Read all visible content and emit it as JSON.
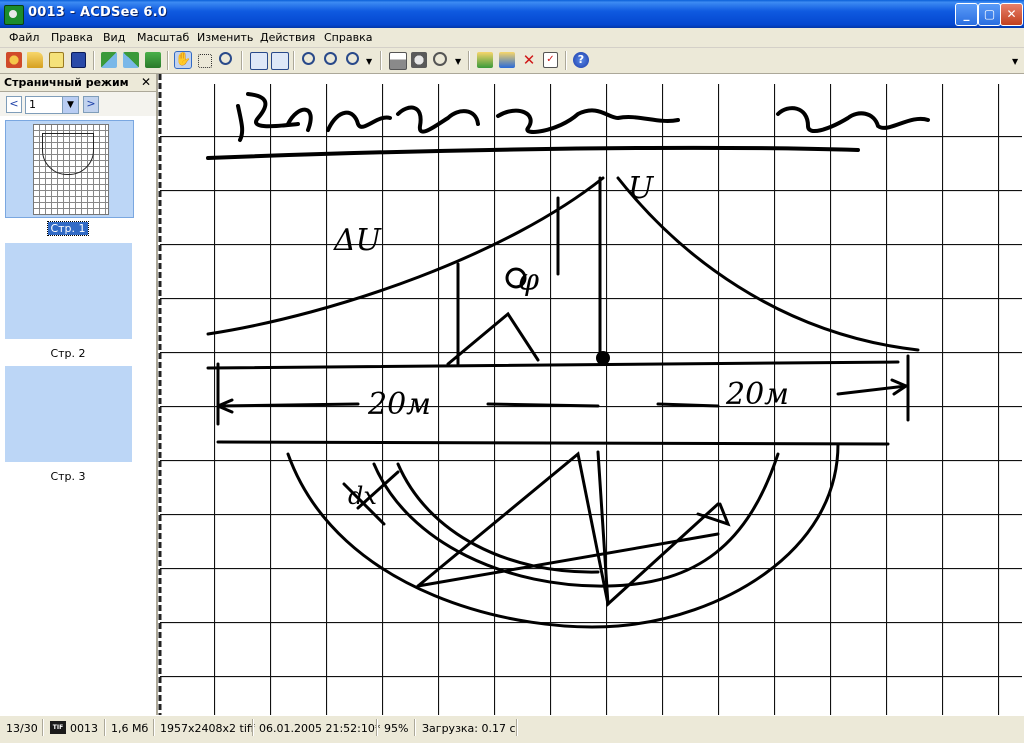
{
  "window": {
    "title": "0013 - ACDSee 6.0",
    "minimize": "_",
    "maximize": "▢",
    "close": "✕"
  },
  "menu": [
    "Файл",
    "Правка",
    "Вид",
    "Масштаб",
    "Изменить",
    "Действия",
    "Справка"
  ],
  "toolbar_icons": [
    "acquire-icon",
    "open-folder-icon",
    "open-file-icon",
    "save-icon",
    "prev-image-icon",
    "next-image-icon",
    "slideshow-icon",
    "hand-tool-icon",
    "select-tool-icon",
    "zoom-tool-icon",
    "rotate-left-icon",
    "rotate-right-icon",
    "zoom-in-icon",
    "zoom-out-icon",
    "zoom-menu-icon",
    "print-icon",
    "email-icon",
    "wallpaper-icon",
    "copy-to-icon",
    "move-to-icon",
    "delete-icon",
    "properties-icon",
    "help-icon"
  ],
  "pane": {
    "title": "Страничный режим",
    "close": "✕",
    "prev": "<",
    "next": ">",
    "page_value": "1",
    "pages": [
      {
        "label": "Стр. 1",
        "selected": true
      },
      {
        "label": "Стр. 2",
        "selected": false
      },
      {
        "label": "Стр. 3",
        "selected": false
      }
    ]
  },
  "status": {
    "index": "13/30",
    "format_badge": "TIF",
    "filename": "0013",
    "size": "1,6 Мб",
    "dimensions": "1957x2408x2 tiff",
    "datetime": "06.01.2005 21:52:10*",
    "zoom": "95%",
    "load_time": "Загрузка: 0.17 с"
  },
  "document": {
    "heading_text": "Напряжение шага",
    "labels": [
      "ΔU",
      "φ",
      "U",
      "20м",
      "20м",
      "dx"
    ]
  },
  "colors": {
    "title_bar": "#0447d0",
    "selection": "#316ac5",
    "thumb_bg": "#bcd6f6"
  }
}
